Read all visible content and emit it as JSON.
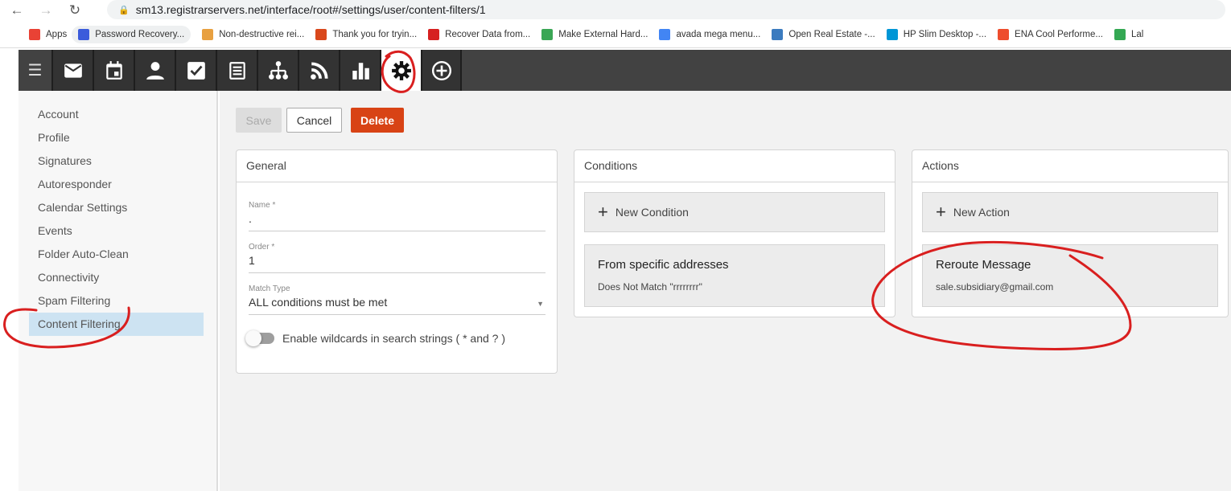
{
  "browser": {
    "url": "sm13.registrarservers.net/interface/root#/settings/user/content-filters/1",
    "bookmarks": [
      {
        "label": "Apps",
        "color": "#e94235"
      },
      {
        "label": "Password Recovery...",
        "color": "#3b5bdb"
      },
      {
        "label": "Non-destructive rei...",
        "color": "#e8a040"
      },
      {
        "label": "Thank you for tryin...",
        "color": "#d9481c"
      },
      {
        "label": "Recover Data from...",
        "color": "#d62020"
      },
      {
        "label": "Make External Hard...",
        "color": "#3aa655"
      },
      {
        "label": "avada mega menu...",
        "color": "#4285f4"
      },
      {
        "label": "Open Real Estate -...",
        "color": "#3b7bbf"
      },
      {
        "label": "HP Slim Desktop -...",
        "color": "#0096d6"
      },
      {
        "label": "ENA Cool Performe...",
        "color": "#ee4d2d"
      },
      {
        "label": "Lal",
        "color": "#34a853"
      }
    ]
  },
  "toolbar": {
    "icons": [
      "mail-icon",
      "calendar-icon",
      "contacts-icon",
      "tasks-icon",
      "notes-icon",
      "hierarchy-icon",
      "rss-icon",
      "reports-icon",
      "settings-icon",
      "add-icon"
    ],
    "active": "settings-icon"
  },
  "sidebar": {
    "items": [
      "Account",
      "Profile",
      "Signatures",
      "Autoresponder",
      "Calendar Settings",
      "Events",
      "Folder Auto-Clean",
      "Connectivity",
      "Spam Filtering",
      "Content Filtering"
    ],
    "selected": "Content Filtering"
  },
  "actions": {
    "save": "Save",
    "cancel": "Cancel",
    "delete": "Delete",
    "delete_color": "#d84315"
  },
  "general": {
    "title": "General",
    "name_label": "Name *",
    "name_value": ".",
    "order_label": "Order *",
    "order_value": "1",
    "match_label": "Match Type",
    "match_value": "ALL conditions must be met",
    "wildcard_label": "Enable wildcards in search strings ( * and ? )",
    "wildcard_on": false
  },
  "conditions": {
    "title": "Conditions",
    "new_label": "New Condition",
    "items": [
      {
        "title": "From specific addresses",
        "detail": "Does Not Match \"rrrrrrrr\""
      }
    ]
  },
  "actions_card": {
    "title": "Actions",
    "new_label": "New Action",
    "items": [
      {
        "title": "Reroute Message",
        "detail": "sale.subsidiary@gmail.com"
      }
    ]
  },
  "annotation_color": "#d91f1f"
}
